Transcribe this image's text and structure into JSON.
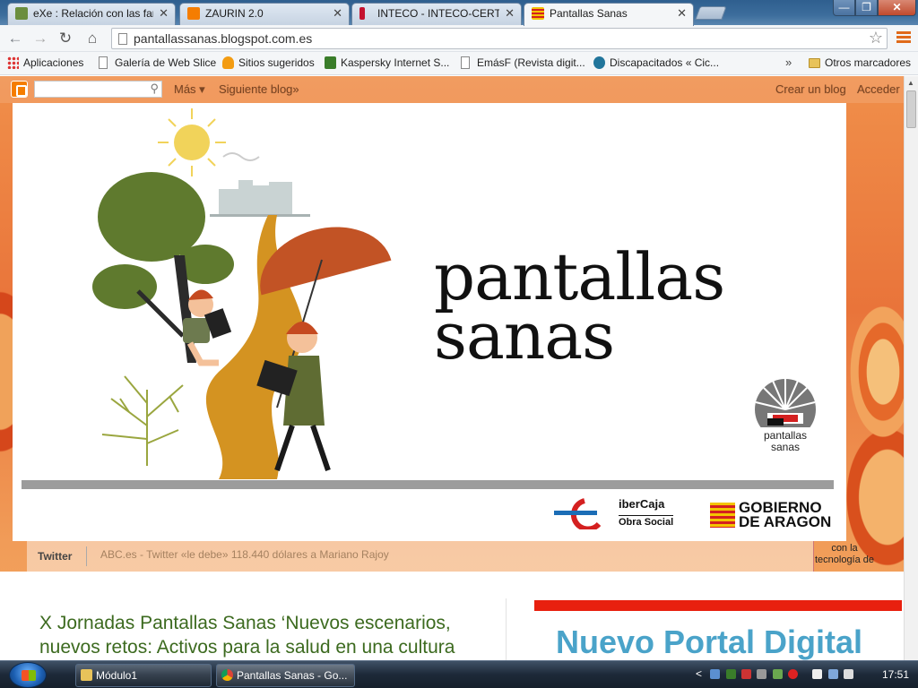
{
  "browser": {
    "tabs": [
      {
        "title": "eXe : Relación con las fam",
        "icon": "exe-icon",
        "color": "#6b8e3f",
        "active": false
      },
      {
        "title": "ZAURIN 2.0",
        "icon": "blogger-icon",
        "color": "#f57d00",
        "active": false
      },
      {
        "title": "INTECO - INTECO-CERT",
        "icon": "inteco-icon",
        "color": "#c4122f",
        "active": false
      },
      {
        "title": "Pantallas Sanas",
        "icon": "aragon-flag-icon",
        "color": "#e8a000",
        "active": true
      }
    ],
    "tab_close": "✕",
    "window_controls": {
      "minimize": "—",
      "maximize": "❐",
      "close": "✕"
    },
    "url": "pantallassanas.blogspot.com.es",
    "bookmarks": [
      {
        "label": "Aplicaciones",
        "icon": "apps-grid-icon"
      },
      {
        "label": "Galería de Web Slice",
        "icon": "page-icon"
      },
      {
        "label": "Sitios sugeridos",
        "icon": "suggested-sites-icon"
      },
      {
        "label": "Kaspersky Internet S...",
        "icon": "kaspersky-icon"
      },
      {
        "label": "EmásF (Revista digit...",
        "icon": "page-icon"
      },
      {
        "label": "Discapacitados « Cic...",
        "icon": "wordpress-icon"
      }
    ],
    "bookmarks_overflow": "»",
    "other_bookmarks": "Otros marcadores"
  },
  "blogger_bar": {
    "more": "Más ▾",
    "next_blog": "Siguiente blog»",
    "create_blog": "Crear un blog",
    "sign_in": "Acceder"
  },
  "header": {
    "title_line1": "pantallas",
    "title_line2": "sanas",
    "mark_label_1": "pantallas",
    "mark_label_2": "sanas",
    "sponsor_ibercaja_name": "iberCaja",
    "sponsor_ibercaja_sub": "Obra Social",
    "sponsor_gobierno_1": "GOBIERNO",
    "sponsor_gobierno_2": "DE ARAGON"
  },
  "ticker": {
    "label": "Twitter",
    "text": "ABC.es - Twitter «le debe» 118.440 dólares a Mariano Rajoy",
    "powered_by": "con la tecnología de"
  },
  "content": {
    "post_title": "X Jornadas Pantallas Sanas ‘Nuevos escenarios, nuevos retos: Activos para la salud en una cultura",
    "portal_title": "Nuevo Portal Digital"
  },
  "taskbar": {
    "items": [
      {
        "label": "Módulo1",
        "icon": "folder-icon"
      },
      {
        "label": "Pantallas Sanas - Go...",
        "icon": "chrome-icon"
      }
    ],
    "tray_arrow": "<",
    "clock": "17:51"
  }
}
